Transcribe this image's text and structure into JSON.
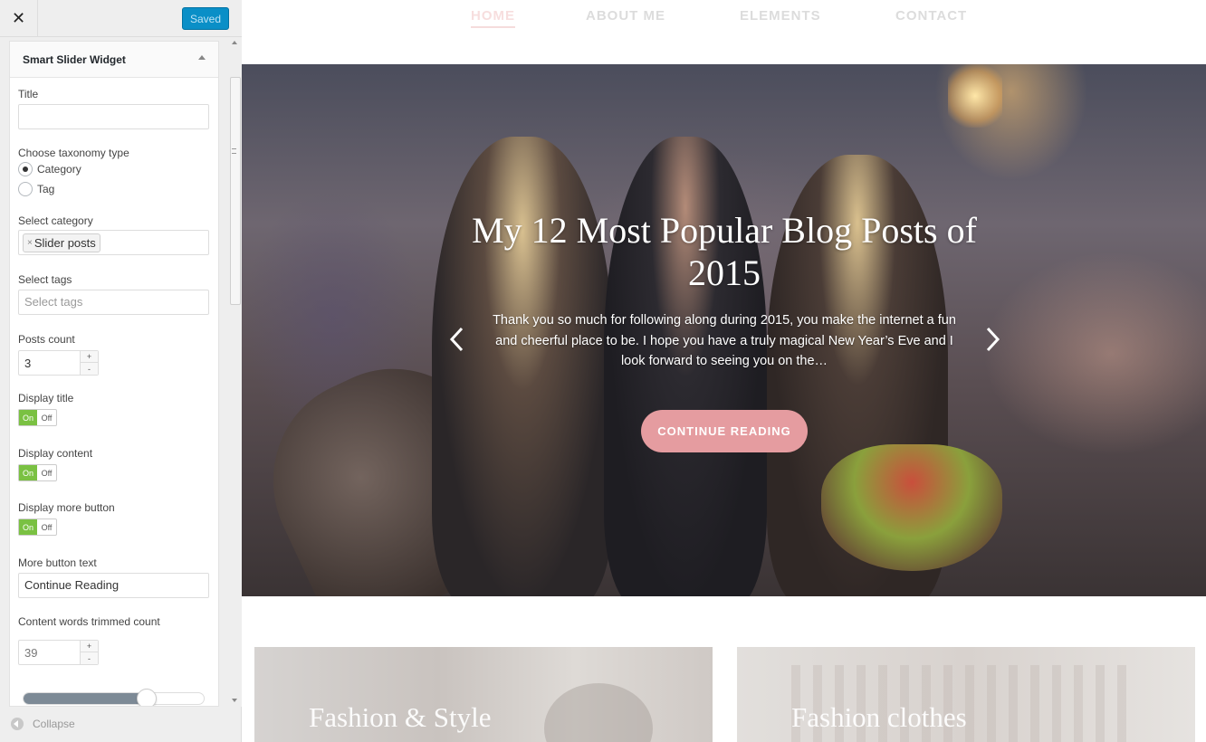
{
  "sidebar": {
    "close_glyph": "✕",
    "saved_label": "Saved",
    "widget_title": "Smart Slider Widget",
    "fields": {
      "title_label": "Title",
      "title_value": "",
      "taxonomy_label": "Choose taxonomy type",
      "taxonomy_options": [
        "Category",
        "Tag"
      ],
      "taxonomy_selected": "Category",
      "category_label": "Select category",
      "category_chip": "Slider posts",
      "category_chip_remove": "×",
      "tags_label": "Select tags",
      "tags_placeholder": "Select tags",
      "posts_count_label": "Posts count",
      "posts_count_value": "3",
      "display_title_label": "Display title",
      "display_content_label": "Display content",
      "display_more_label": "Display more button",
      "toggle_on": "On",
      "toggle_off": "Off",
      "more_text_label": "More button text",
      "more_text_value": "Continue Reading",
      "words_count_label": "Content words trimmed count",
      "words_count_value": "39",
      "stepper_up": "+",
      "stepper_down": "-"
    },
    "slider_level": 0.69,
    "collapse_label": "Collapse"
  },
  "preview": {
    "nav": [
      "HOME",
      "ABOUT ME",
      "ELEMENTS",
      "CONTACT"
    ],
    "nav_active": "HOME",
    "hero": {
      "title": "My 12 Most Popular Blog Posts of 2015",
      "excerpt": "Thank you so much for following along during 2015, you make the internet a fun and cheerful place to be. I hope you have a truly magical New Year’s Eve and I look forward to seeing you on the…",
      "button": "CONTINUE READING"
    },
    "cards": [
      "Fashion & Style",
      "Fashion clothes"
    ]
  },
  "colors": {
    "saved_button": "#0a8fc7",
    "toggle_on": "#7ac142",
    "hero_button": "#e59ca0"
  }
}
